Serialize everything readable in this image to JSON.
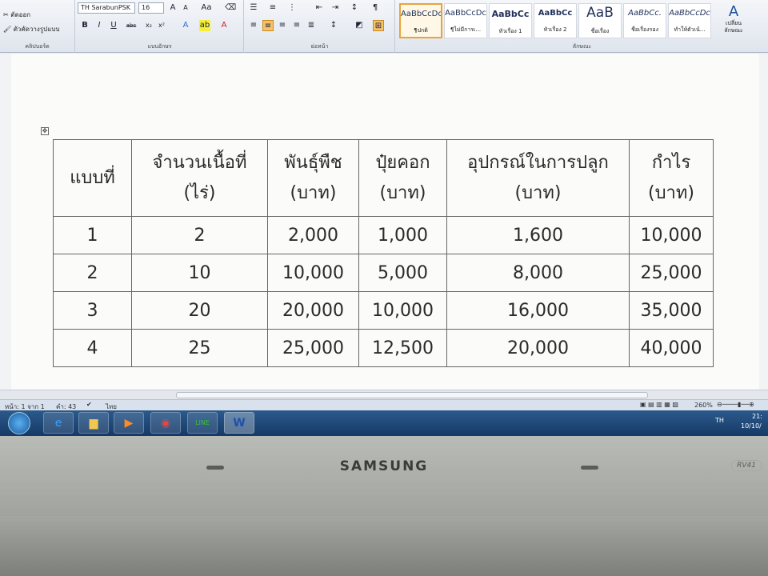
{
  "ribbon": {
    "clipboard": {
      "cut_label": "ตัดออก",
      "format_painter_label": "ตัวคัดวางรูปแบบ",
      "group_label": "คลิปบอร์ด"
    },
    "font": {
      "font_name": "TH SarabunPSK",
      "font_size": "16",
      "group_label": "แบบอักษร"
    },
    "paragraph": {
      "group_label": "ย่อหน้า"
    },
    "styles": {
      "group_label": "ลักษณะ",
      "items": [
        {
          "sample": "AaBbCcDc",
          "name": "¶ปกติ"
        },
        {
          "sample": "AaBbCcDc",
          "name": "¶ไม่มีการเ..."
        },
        {
          "sample": "AaBbCc",
          "name": "หัวเรื่อง 1"
        },
        {
          "sample": "AaBbCc",
          "name": "หัวเรื่อง 2"
        },
        {
          "sample": "AaB",
          "name": "ชื่อเรื่อง"
        },
        {
          "sample": "AaBbCc.",
          "name": "ชื่อเรื่องรอง"
        },
        {
          "sample": "AaBbCcDc",
          "name": "ทำให้ตัวเน้..."
        }
      ],
      "change_styles_label": "เปลี่ยน ลักษณะ"
    }
  },
  "table": {
    "headers": [
      [
        "แบบที่",
        ""
      ],
      [
        "จำนวนเนื้อที่",
        "(ไร่)"
      ],
      [
        "พันธุ์พืช",
        "(บาท)"
      ],
      [
        "ปุ๋ยคอก",
        "(บาท)"
      ],
      [
        "อุปกรณ์ในการปลูก",
        "(บาท)"
      ],
      [
        "กำไร",
        "(บาท)"
      ]
    ],
    "rows": [
      [
        "1",
        "2",
        "2,000",
        "1,000",
        "1,600",
        "10,000"
      ],
      [
        "2",
        "10",
        "10,000",
        "5,000",
        "8,000",
        "25,000"
      ],
      [
        "3",
        "20",
        "20,000",
        "10,000",
        "16,000",
        "35,000"
      ],
      [
        "4",
        "25",
        "25,000",
        "12,500",
        "20,000",
        "40,000"
      ]
    ]
  },
  "status": {
    "page": "หน้า: 1 จาก 1",
    "words": "คำ: 43",
    "language": "ไทย",
    "zoom": "260%"
  },
  "taskbar": {
    "language": "TH",
    "time": "21:",
    "date": "10/10/"
  },
  "bezel": {
    "brand": "SAMSUNG",
    "model": "RV41"
  }
}
